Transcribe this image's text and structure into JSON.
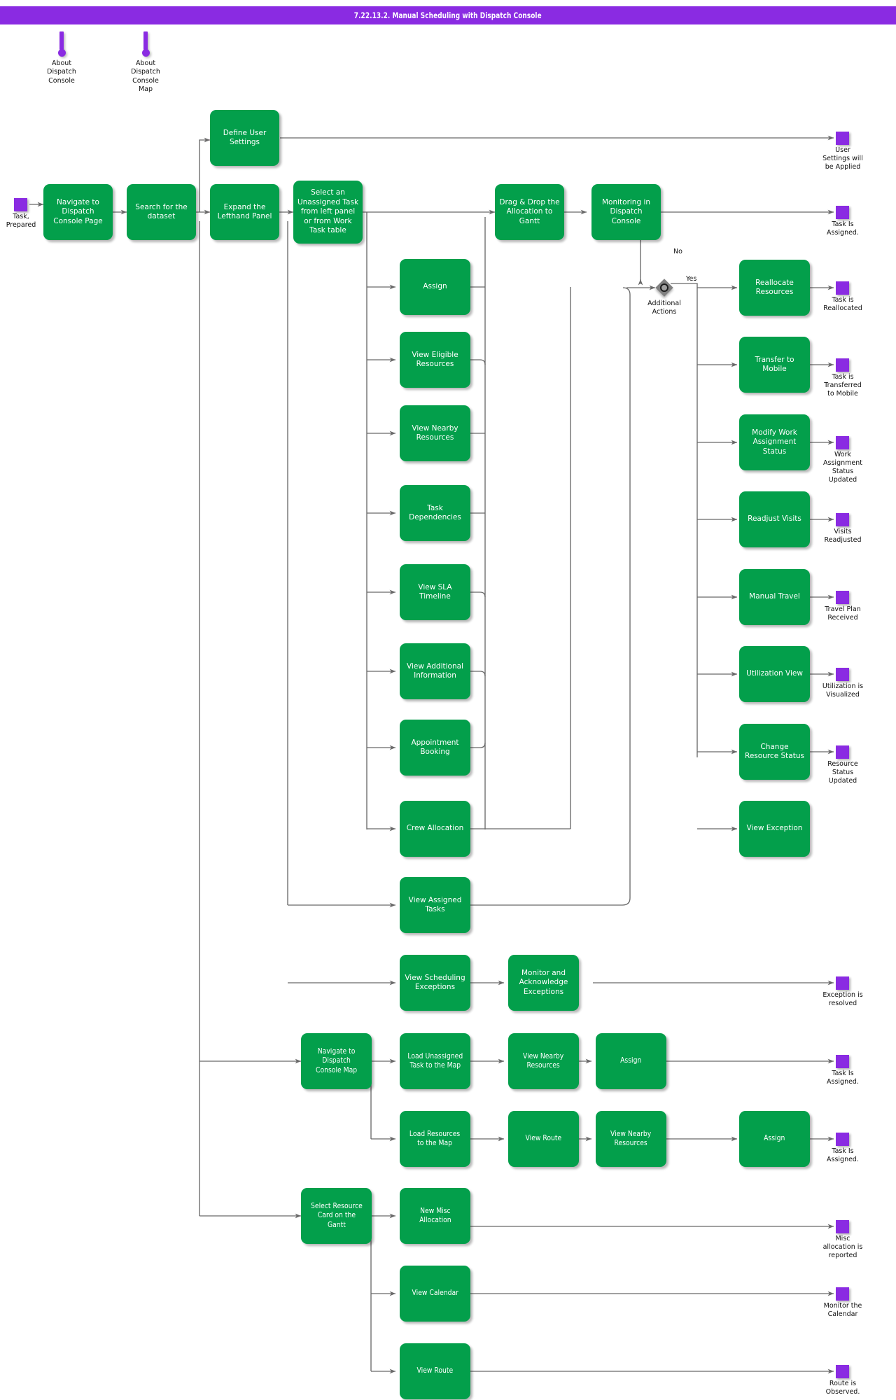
{
  "header": {
    "title": "7.22.13.2. Manual Scheduling with Dispatch Console"
  },
  "colors": {
    "title_bar": "#8A2BE2",
    "activity": "#039F4B",
    "terminator": "#8A2BE2",
    "decision": "#808080",
    "edge": "#696969",
    "text_on_node": "#FFFFFF",
    "page_background": "#FFFFFF"
  },
  "notes": [
    {
      "id": "note-about-dispatch-console",
      "label": "About\nDispatch\nConsole"
    },
    {
      "id": "note-about-dispatch-console-map",
      "label": "About\nDispatch\nConsole\nMap"
    }
  ],
  "start": {
    "id": "start-task-prepared",
    "label": "Task,\nPrepared"
  },
  "decision": {
    "id": "decision-additional-actions",
    "label": "Additional\nActions",
    "no_label": "No",
    "yes_label": "Yes"
  },
  "activities": [
    {
      "id": "navigate-to-dispatch-console-page",
      "label": "Navigate to\nDispatch\nConsole Page"
    },
    {
      "id": "search-for-the-dataset",
      "label": "Search for the\ndataset"
    },
    {
      "id": "expand-the-lefthand-panel",
      "label": "Expand the\nLefthand Panel"
    },
    {
      "id": "define-user-settings",
      "label": "Define User\nSettings"
    },
    {
      "id": "select-an-unassigned-task",
      "label": "Select an\nUnassigned Task\nfrom left panel\nor from Work\nTask table"
    },
    {
      "id": "drag-drop-the-allocation-to-gantt",
      "label": "Drag & Drop the\nAllocation to\nGantt"
    },
    {
      "id": "monitoring-in-dispatch-console",
      "label": "Monitoring in\nDispatch\nConsole"
    },
    {
      "id": "assign",
      "label": "Assign"
    },
    {
      "id": "view-eligible-resources",
      "label": "View Eligible\nResources"
    },
    {
      "id": "view-nearby-resources",
      "label": "View Nearby\nResources"
    },
    {
      "id": "task-dependencies",
      "label": "Task\nDependencies"
    },
    {
      "id": "view-sla-timeline",
      "label": "View SLA\nTimeline"
    },
    {
      "id": "view-additional-information",
      "label": "View Additional\nInformation"
    },
    {
      "id": "appointment-booking",
      "label": "Appointment\nBooking"
    },
    {
      "id": "crew-allocation",
      "label": "Crew Allocation"
    },
    {
      "id": "view-assigned-tasks",
      "label": "View Assigned\nTasks"
    },
    {
      "id": "view-scheduling-exceptions",
      "label": "View Scheduling\nExceptions"
    },
    {
      "id": "monitor-and-acknowledge-exceptions",
      "label": "Monitor and\nAcknowledge\nExceptions"
    },
    {
      "id": "reallocate-resources",
      "label": "Reallocate\nResources"
    },
    {
      "id": "transfer-to-mobile",
      "label": "Transfer to\nMobile"
    },
    {
      "id": "modify-work-assignment-status",
      "label": "Modify Work\nAssignment\nStatus"
    },
    {
      "id": "readjust-visits",
      "label": "Readjust Visits"
    },
    {
      "id": "manual-travel",
      "label": "Manual Travel"
    },
    {
      "id": "utilization-view",
      "label": "Utilization View"
    },
    {
      "id": "change-resource-status",
      "label": "Change\nResource Status"
    },
    {
      "id": "view-exception",
      "label": "View Exception"
    },
    {
      "id": "navigate-to-dispatch-console-map",
      "label": "Navigate to\nDispatch\nConsole Map"
    },
    {
      "id": "load-unassigned-task-to-the-map",
      "label": "Load Unassigned\nTask to the Map"
    },
    {
      "id": "map-view-nearby-resources-1",
      "label": "View Nearby\nResources"
    },
    {
      "id": "map-assign-1",
      "label": "Assign"
    },
    {
      "id": "load-resources-to-the-map",
      "label": "Load Resources\nto the Map"
    },
    {
      "id": "map-view-route",
      "label": "View Route"
    },
    {
      "id": "map-view-nearby-resources-2",
      "label": "View Nearby\nResources"
    },
    {
      "id": "map-assign-2",
      "label": "Assign"
    },
    {
      "id": "select-resource-card-on-the-gantt",
      "label": "Select Resource\nCard on the\nGantt"
    },
    {
      "id": "new-misc-allocation",
      "label": "New Misc\nAllocation"
    },
    {
      "id": "view-calendar",
      "label": "View Calendar"
    },
    {
      "id": "gantt-view-route",
      "label": "View Route"
    }
  ],
  "terminators": [
    {
      "id": "end-user-settings-will-be-applied",
      "label": "User\nSettings will\nbe Applied"
    },
    {
      "id": "end-task-is-assigned-main",
      "label": "Task Is\nAssigned."
    },
    {
      "id": "end-task-is-reallocated",
      "label": "Task is\nReallocated"
    },
    {
      "id": "end-task-is-transferred-to-mobile",
      "label": "Task is\nTransferred\nto Mobile"
    },
    {
      "id": "end-work-assignment-status-updated",
      "label": "Work\nAssignment\nStatus\nUpdated"
    },
    {
      "id": "end-visits-readjusted",
      "label": "Visits\nReadjusted"
    },
    {
      "id": "end-travel-plan-received",
      "label": "Travel Plan\nReceived"
    },
    {
      "id": "end-utilization-is-visualized",
      "label": "Utilization is\nVisualized"
    },
    {
      "id": "end-resource-status-updated",
      "label": "Resource\nStatus\nUpdated"
    },
    {
      "id": "end-exception-is-resolved",
      "label": "Exception is\nresolved"
    },
    {
      "id": "end-task-is-assigned-map-1",
      "label": "Task Is\nAssigned."
    },
    {
      "id": "end-task-is-assigned-map-2",
      "label": "Task Is\nAssigned."
    },
    {
      "id": "end-misc-allocation-is-reported",
      "label": "Misc\nallocation is\nreported"
    },
    {
      "id": "end-monitor-the-calendar",
      "label": "Monitor the\nCalendar"
    },
    {
      "id": "end-route-is-observed",
      "label": "Route is\nObserved."
    }
  ]
}
